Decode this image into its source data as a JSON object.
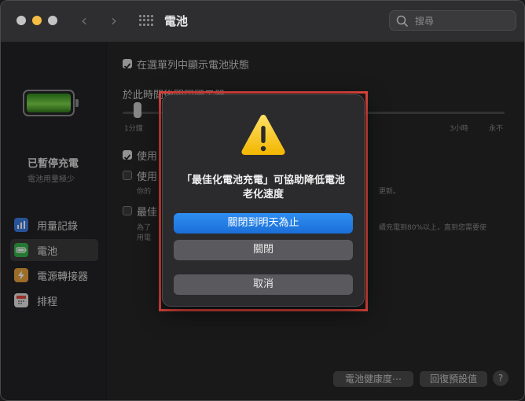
{
  "window": {
    "title": "電池"
  },
  "search": {
    "placeholder": "搜尋"
  },
  "sidebar": {
    "status": "已暫停充電",
    "status_sub": "電池用量極少",
    "items": [
      {
        "label": "用量記錄",
        "icon": "chart-icon",
        "color": "#3c7be0"
      },
      {
        "label": "電池",
        "icon": "battery-icon",
        "color": "#36b24a"
      },
      {
        "label": "電源轉接器",
        "icon": "bolt-icon",
        "color": "#e6a13a"
      },
      {
        "label": "排程",
        "icon": "calendar-icon",
        "color": "#e0e0e0"
      }
    ]
  },
  "main": {
    "show_in_menu_bar": "在選單列中顯示電池狀態",
    "turn_off_label": "於此時間後關閉顯示器：",
    "slider_labels": {
      "min": "1分鐘",
      "three_hours": "3小時",
      "never": "永不"
    },
    "option_2_prefix": "使用",
    "option_3_prefix": "使用",
    "option_3_sub_start": "你的",
    "option_3_sub_end": "更新。",
    "option_4_prefix": "最佳",
    "option_4_line1_start": "為了",
    "option_4_line1_end": "續充電到80%以上，直到您需要使",
    "option_4_line2_start": "用電",
    "battery_health_button": "電池健康度⋯",
    "restore_defaults_button": "回復預設值",
    "help_label": "?"
  },
  "dialog": {
    "message_line1": "「最佳化電池充電」可協助降低電池",
    "message_line2": "老化速度",
    "turn_off_until_tomorrow": "關閉到明天為止",
    "turn_off": "關閉",
    "cancel": "取消"
  },
  "colors": {
    "highlight": "#e2463e",
    "primary_button": "#1a6fd8",
    "warning": "#f5c400"
  }
}
